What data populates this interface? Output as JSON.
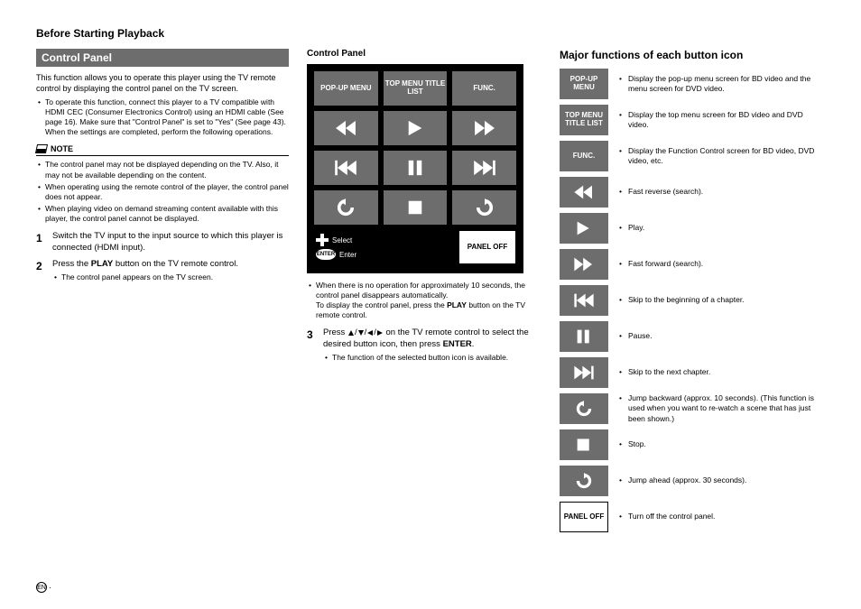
{
  "page": {
    "section_title": "Before Starting Playback",
    "heading": "Control Panel",
    "footer_lang": "EN"
  },
  "left": {
    "intro": "This function allows you to operate this player using the TV remote control by displaying the control panel on the TV screen.",
    "op_bullet": "To operate this function, connect this player to a TV compatible with HDMI CEC (Consumer Electronics Control) using an HDMI cable (See page 16). Make sure that \"Control Panel\" is set to \"Yes\" (See page 43). When the settings are completed, perform the following operations.",
    "note_label": "NOTE",
    "notes": [
      "The control panel may not be displayed depending on the TV. Also, it may not be available depending on the content.",
      "When operating using the remote control of the player, the control panel does not appear.",
      "When playing video on demand streaming content available with this player, the control panel cannot be displayed."
    ],
    "step1": "Switch the TV input to the input source to which this player is connected (HDMI input).",
    "step2_prefix": "Press the ",
    "step2_bold": "PLAY",
    "step2_suffix": " button on the TV remote control.",
    "step2_sub": "The control panel appears on the TV screen."
  },
  "mid": {
    "subheading": "Control Panel",
    "cells": {
      "popup": "POP-UP MENU",
      "topmenu": "TOP MENU TITLE LIST",
      "func": "FUNC.",
      "paneloff": "PANEL OFF"
    },
    "hints": {
      "select": "Select",
      "enter": "Enter",
      "enter_badge": "ENTER"
    },
    "below1a": "When there is no operation for approximately 10 seconds, the control panel disappears automatically.",
    "below1b_prefix": "To display the control panel, press the ",
    "below1b_bold": "PLAY",
    "below1b_suffix": " button on the TV remote control.",
    "step3_prefix": "Press ",
    "step3_mid": " on the TV remote control to select the desired button icon, then press ",
    "step3_bold": "ENTER",
    "step3_suffix": ".",
    "step3_sub": "The function of the selected button icon is available."
  },
  "right": {
    "title": "Major functions of each button icon",
    "rows": [
      {
        "kind": "text",
        "label": "POP-UP MENU",
        "desc": "Display the pop-up menu screen for BD video and the menu screen for DVD video."
      },
      {
        "kind": "text",
        "label": "TOP MENU TITLE LIST",
        "desc": "Display the top menu screen for BD video and DVD video."
      },
      {
        "kind": "text",
        "label": "FUNC.",
        "desc": "Display the Function Control screen for BD video, DVD video, etc."
      },
      {
        "kind": "icon",
        "icon": "frev",
        "desc": "Fast reverse (search)."
      },
      {
        "kind": "icon",
        "icon": "play",
        "desc": "Play."
      },
      {
        "kind": "icon",
        "icon": "ffwd",
        "desc": "Fast forward (search)."
      },
      {
        "kind": "icon",
        "icon": "skipb",
        "desc": "Skip to the beginning of a chapter."
      },
      {
        "kind": "icon",
        "icon": "pause",
        "desc": "Pause."
      },
      {
        "kind": "icon",
        "icon": "skipf",
        "desc": "Skip to the next chapter."
      },
      {
        "kind": "icon",
        "icon": "jumpb",
        "desc": "Jump backward (approx. 10 seconds). (This function is used when you want to re-watch a scene that has just been shown.)"
      },
      {
        "kind": "icon",
        "icon": "stop",
        "desc": "Stop."
      },
      {
        "kind": "icon",
        "icon": "jumpf",
        "desc": "Jump ahead (approx. 30 seconds)."
      },
      {
        "kind": "whitetext",
        "label": "PANEL OFF",
        "desc": "Turn off the control panel."
      }
    ]
  }
}
